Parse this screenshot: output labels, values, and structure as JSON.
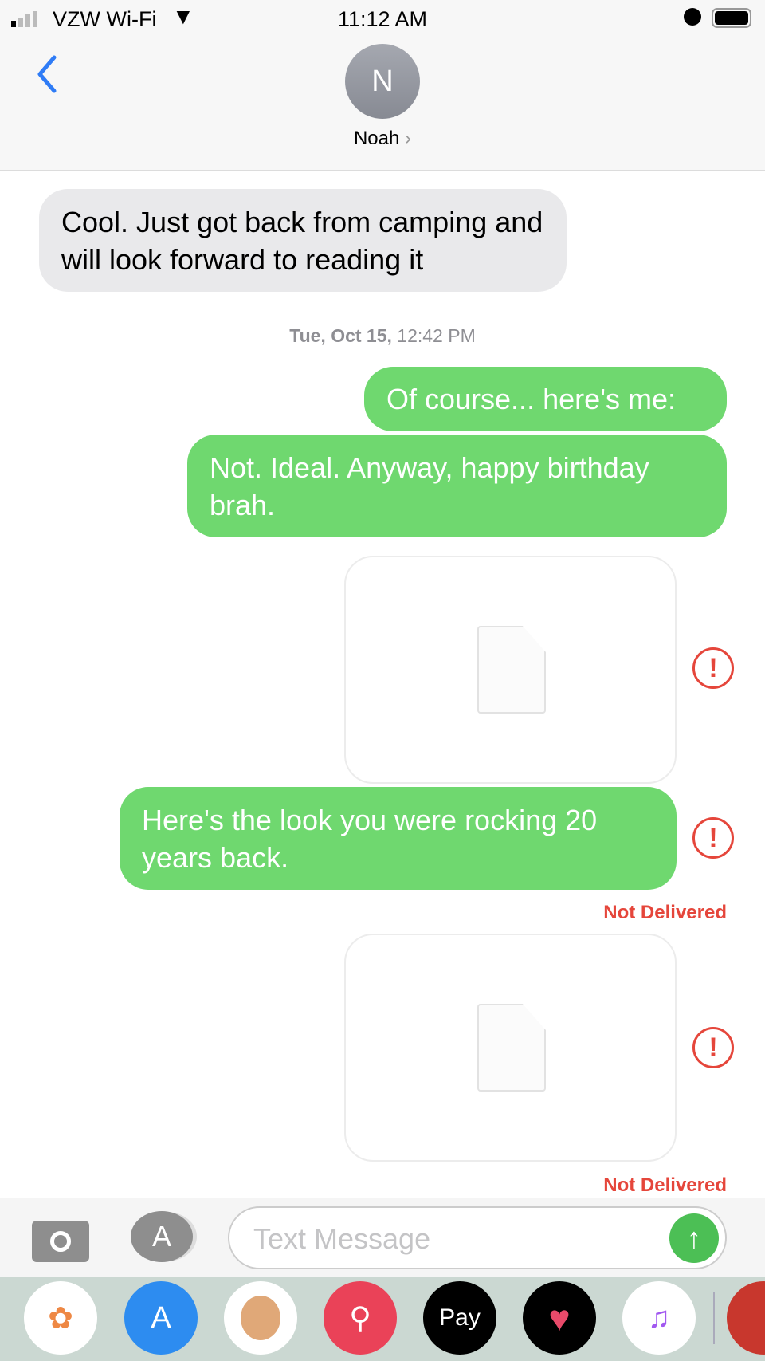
{
  "status_bar": {
    "carrier": "VZW Wi-Fi",
    "time": "11:12 AM",
    "icons": [
      "signal-icon",
      "wifi-icon",
      "alarm-icon",
      "battery-icon"
    ]
  },
  "header": {
    "avatar_initial": "N",
    "contact_name": "Noah",
    "back_icon": "chevron-left-icon"
  },
  "messages": [
    {
      "type": "received",
      "text": "Cool. Just got back from camping and will look forward to reading it"
    },
    {
      "type": "timestamp",
      "day": "Tue, Oct 15,",
      "time": "12:42 PM"
    },
    {
      "type": "sent",
      "text": "Of course... here's me:"
    },
    {
      "type": "sent",
      "text": "Not. Ideal. Anyway, happy birthday brah."
    },
    {
      "type": "attachment",
      "failed": true
    },
    {
      "type": "sent",
      "text": "Here's the look you were rocking 20 years back.",
      "failed": true,
      "status": "Not Delivered"
    },
    {
      "type": "attachment",
      "failed": true,
      "status": "Not Delivered"
    }
  ],
  "compose": {
    "placeholder": "Text Message"
  },
  "app_drawer": {
    "apps": [
      "Photos",
      "App Store",
      "Memoji",
      "Images Search",
      "Apple Pay",
      "Digital Touch",
      "Music",
      "Animoji"
    ],
    "apple_pay_label": "Pay"
  },
  "colors": {
    "sent": "#6fd86f",
    "received": "#e9e9eb",
    "error": "#e5463b",
    "link": "#2f7cf6"
  }
}
